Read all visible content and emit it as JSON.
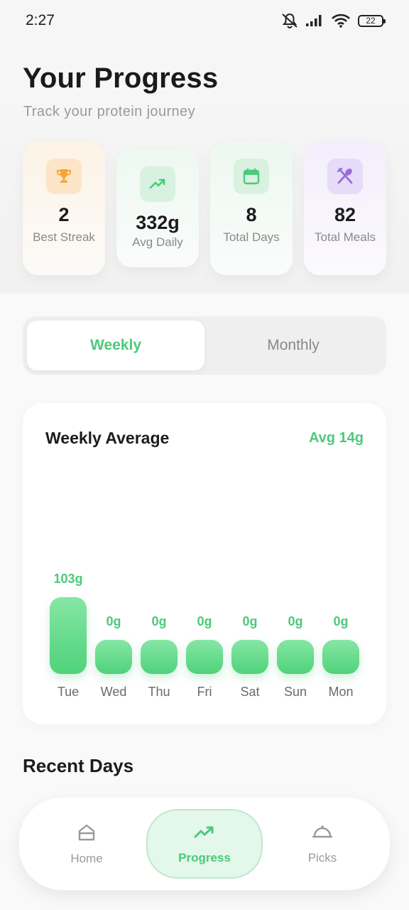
{
  "status_bar": {
    "time": "2:27",
    "battery": "22"
  },
  "header": {
    "title": "Your Progress",
    "subtitle": "Track your protein journey"
  },
  "stats": [
    {
      "value": "2",
      "label": "Best Streak",
      "icon": "trophy-icon",
      "accent": "#f2a73b"
    },
    {
      "value": "332g",
      "label": "Avg Daily",
      "icon": "trending-up-icon",
      "accent": "#4cc97a"
    },
    {
      "value": "8",
      "label": "Total Days",
      "icon": "calendar-icon",
      "accent": "#4cc97a"
    },
    {
      "value": "82",
      "label": "Total Meals",
      "icon": "utensils-icon",
      "accent": "#9a6bd8"
    }
  ],
  "toggle": {
    "weekly": "Weekly",
    "monthly": "Monthly",
    "selected": "Weekly"
  },
  "chart": {
    "title": "Weekly Average",
    "avg_label": "Avg 14g"
  },
  "chart_data": {
    "type": "bar",
    "categories": [
      "Tue",
      "Wed",
      "Thu",
      "Fri",
      "Sat",
      "Sun",
      "Mon"
    ],
    "values": [
      103,
      0,
      0,
      0,
      0,
      0,
      0
    ],
    "value_labels": [
      "103g",
      "0g",
      "0g",
      "0g",
      "0g",
      "0g",
      "0g"
    ],
    "color": "#4cc97a"
  },
  "recent": {
    "title": "Recent Days"
  },
  "nav": {
    "items": [
      {
        "label": "Home",
        "icon": "home-icon"
      },
      {
        "label": "Progress",
        "icon": "trending-up-icon"
      },
      {
        "label": "Picks",
        "icon": "cloche-icon"
      }
    ],
    "active": "Progress"
  }
}
